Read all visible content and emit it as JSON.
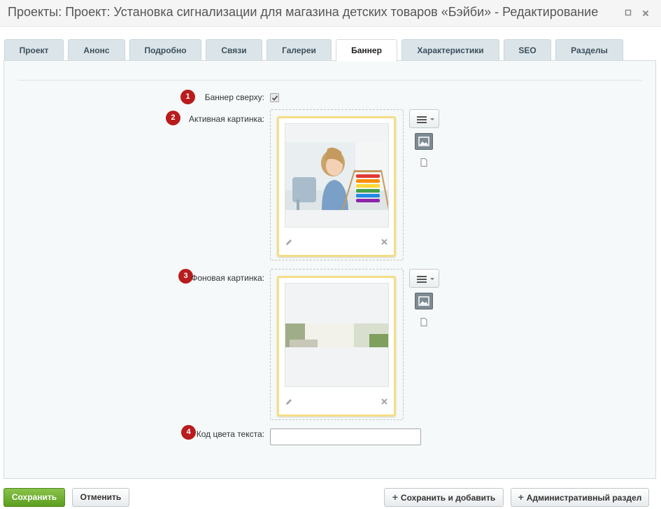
{
  "window": {
    "title": "Проекты: Проект: Установка сигнализации для магазина детских товаров «Бэйби» - Редактирование"
  },
  "tabs": [
    {
      "label": "Проект"
    },
    {
      "label": "Анонс"
    },
    {
      "label": "Подробно"
    },
    {
      "label": "Связи"
    },
    {
      "label": "Галереи"
    },
    {
      "label": "Баннер",
      "active": true
    },
    {
      "label": "Характеристики"
    },
    {
      "label": "SEO"
    },
    {
      "label": "Разделы"
    }
  ],
  "form": {
    "banner_top": {
      "badge": "1",
      "label": "Баннер сверху:",
      "checked": true
    },
    "active_image": {
      "badge": "2",
      "label": "Активная картинка:",
      "image_icon": "photo-of-girl-with-abacus"
    },
    "background_image": {
      "badge": "3",
      "label": "Фоновая картинка:",
      "image_icon": "photo-of-interior-strip"
    },
    "text_color": {
      "badge": "4",
      "label": "Код цвета текста:",
      "value": ""
    }
  },
  "footer": {
    "save": "Сохранить",
    "cancel": "Отменить",
    "save_add": "Сохранить и добавить",
    "admin": "Административный раздел"
  },
  "colors": {
    "tab_bg": "#dbe5e9",
    "badge": "#b91c1c",
    "frame_border": "#f5dd84",
    "save_button": "#6aae2a",
    "panel_bg": "#f5f9f9"
  },
  "icons": {
    "window_maximize": "square-icon",
    "window_close": "close-icon",
    "frame_edit": "pencil-icon",
    "frame_delete": "close-icon",
    "menu": "hamburger-menu-icon",
    "image": "image-icon",
    "file": "file-icon",
    "plus": "plus-icon"
  }
}
